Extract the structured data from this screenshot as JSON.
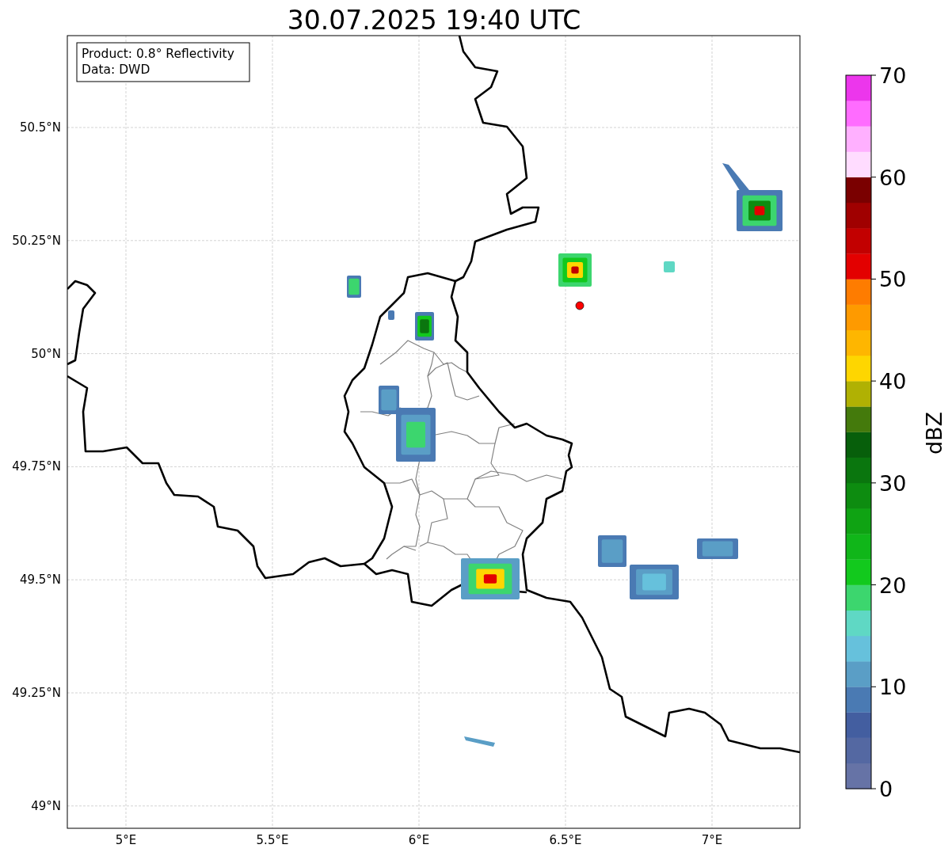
{
  "title": "30.07.2025 19:40 UTC",
  "info_box": {
    "lines": [
      "Product: 0.8° Reflectivity",
      "Data: DWD"
    ]
  },
  "map": {
    "x_ticks": [
      "5°E",
      "5.5°E",
      "6°E",
      "6.5°E",
      "7°E"
    ],
    "y_ticks": [
      "50.5°N",
      "50.25°N",
      "50°N",
      "49.75°N",
      "49.5°N",
      "49.25°N",
      "49°N"
    ]
  },
  "colorbar": {
    "label": "dBZ",
    "ticks": [
      "70",
      "60",
      "50",
      "40",
      "30",
      "20",
      "10",
      "0"
    ],
    "bands": [
      {
        "color": "#6673a6"
      },
      {
        "color": "#5468a2"
      },
      {
        "color": "#435ea0"
      },
      {
        "color": "#4a7ab3"
      },
      {
        "color": "#5a9ec6"
      },
      {
        "color": "#66c1dc"
      },
      {
        "color": "#5fd8c4"
      },
      {
        "color": "#3cd66e"
      },
      {
        "color": "#12c91d"
      },
      {
        "color": "#10b619"
      },
      {
        "color": "#0fa313"
      },
      {
        "color": "#0d8c10"
      },
      {
        "color": "#0a760e"
      },
      {
        "color": "#075f0b"
      },
      {
        "color": "#447a0c"
      },
      {
        "color": "#b0b103"
      },
      {
        "color": "#fed600"
      },
      {
        "color": "#feb600"
      },
      {
        "color": "#fe9a00"
      },
      {
        "color": "#fe7c00"
      },
      {
        "color": "#e30000"
      },
      {
        "color": "#c20000"
      },
      {
        "color": "#a00000"
      },
      {
        "color": "#7a0000"
      },
      {
        "color": "#ffdcff"
      },
      {
        "color": "#ffb0ff"
      },
      {
        "color": "#ff6cff"
      },
      {
        "color": "#ec36ec"
      }
    ]
  }
}
